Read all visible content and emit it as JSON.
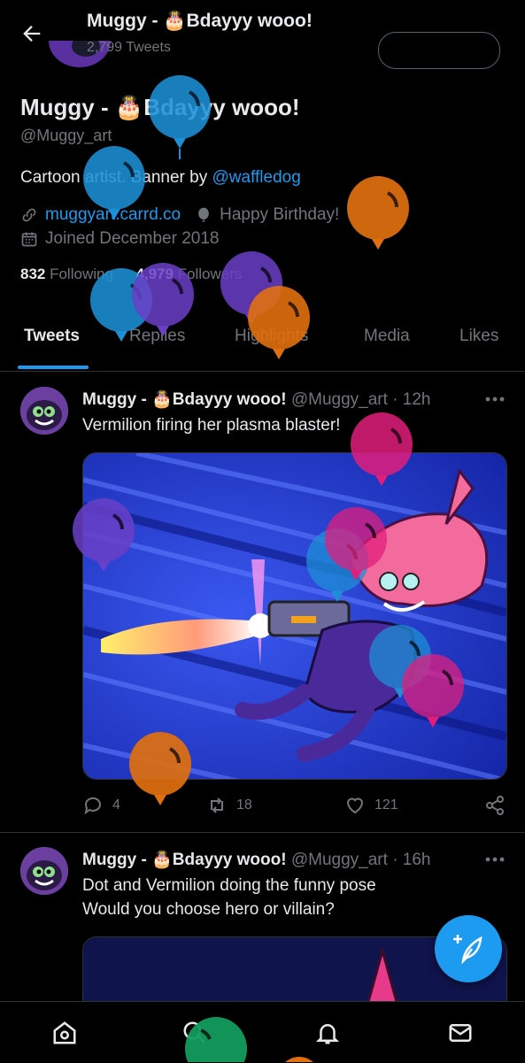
{
  "header": {
    "title": "Muggy - 🎂Bdayyy wooo!",
    "tweet_count": "2,799 Tweets",
    "back_icon": "arrow-left-icon"
  },
  "profile": {
    "name": "Muggy - 🎂Bdayyy wooo!",
    "handle": "@Muggy_art",
    "bio_text": "Cartoon artist. Banner by ",
    "bio_mention": "@waffledog",
    "website": "muggyart.carrd.co",
    "birthday": "Happy Birthday!",
    "joined": "Joined December 2018",
    "following_count": "832",
    "following_label": " Following",
    "followers_count": "4,979",
    "followers_label": " Followers"
  },
  "tabs": [
    {
      "label": "Tweets",
      "active": true
    },
    {
      "label": "Replies",
      "active": false
    },
    {
      "label": "Highlights",
      "active": false
    },
    {
      "label": "Media",
      "active": false
    },
    {
      "label": "Likes",
      "active": false
    }
  ],
  "tweets": [
    {
      "author": "Muggy - 🎂Bdayyy wooo!",
      "handle": "@Muggy_art",
      "time": "· 12h",
      "text_lines": [
        "Vermilion firing her plasma blaster!"
      ],
      "replies": "4",
      "retweets": "18",
      "likes": "121"
    },
    {
      "author": "Muggy - 🎂Bdayyy wooo!",
      "handle": "@Muggy_art",
      "time": "· 16h",
      "text_lines": [
        "Dot and Vermilion doing the funny pose",
        "Would you choose hero or villain?"
      ]
    }
  ],
  "colors": {
    "accent": "#1d9bf0",
    "background": "#000000",
    "text": "#e7e9ea",
    "muted": "#71767b",
    "balloon_blue": "#1d8fd6",
    "balloon_orange": "#e0700f",
    "balloon_purple": "#6a40c8",
    "balloon_pink": "#e21d7c",
    "balloon_green": "#139c5e"
  },
  "bottom_nav": [
    "home-icon",
    "search-icon",
    "notifications-icon",
    "messages-icon"
  ],
  "fab_icon": "compose-tweet-icon"
}
